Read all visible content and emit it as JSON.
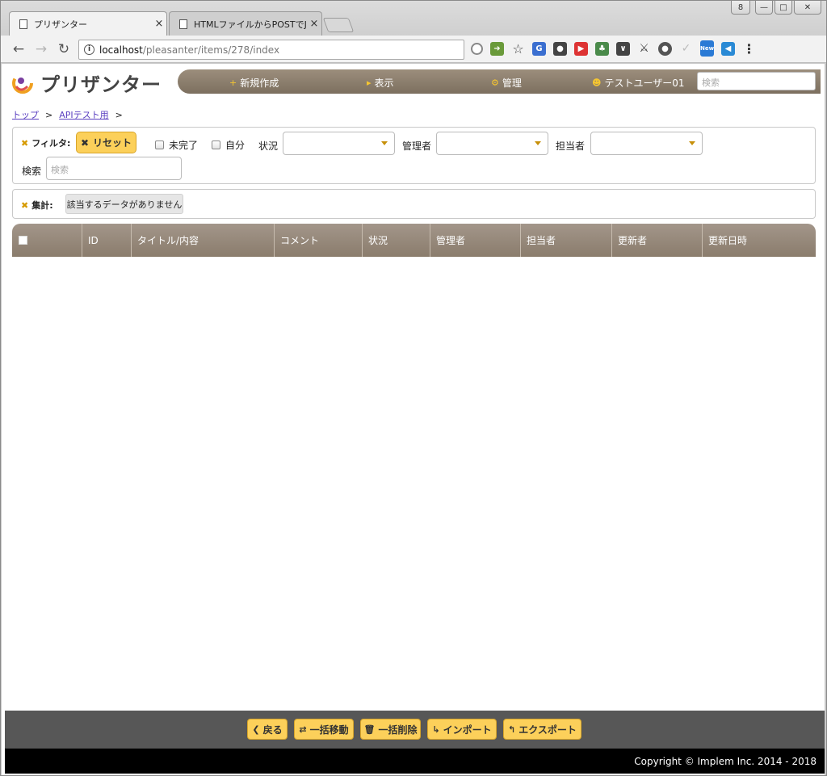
{
  "browser": {
    "tabs": [
      {
        "title": "プリザンター",
        "close": "×"
      },
      {
        "title": "HTMLファイルからPOSTでJ",
        "close": "×"
      }
    ],
    "window_buttons": {
      "user": "8",
      "minimize": "—",
      "maximize": "□",
      "close": "✕"
    },
    "url_host": "localhost",
    "url_path": "/pleasanter/items/278/index",
    "ext_new_badge": "New"
  },
  "app": {
    "logo_text": "プリザンター",
    "nav": {
      "new": "新規作成",
      "view": "表示",
      "manage": "管理",
      "user": "テストユーザー01"
    },
    "search_placeholder": "検索"
  },
  "breadcrumb": {
    "items": [
      "トップ",
      "APIテスト用"
    ],
    "separator": ">"
  },
  "filter": {
    "label": "フィルタ:",
    "reset_label": "リセット",
    "incomplete_label": "未完了",
    "self_label": "自分",
    "status_label": "状況",
    "manager_label": "管理者",
    "owner_label": "担当者",
    "search_label": "検索",
    "search_placeholder": "検索"
  },
  "aggregation": {
    "label": "集計:",
    "no_data": "該当するデータがありません"
  },
  "grid": {
    "columns": [
      "ID",
      "タイトル/内容",
      "コメント",
      "状況",
      "管理者",
      "担当者",
      "更新者",
      "更新日時"
    ]
  },
  "footer": {
    "back": "戻る",
    "bulk_move": "一括移動",
    "bulk_delete": "一括削除",
    "import": "インポート",
    "export": "エクスポート",
    "copyright": "Copyright © Implem Inc. 2014 - 2018"
  },
  "colors": {
    "accent_yellow": "#fcd05a",
    "nav_brown": "#8a7c6c",
    "link_purple": "#5a3fc0"
  }
}
